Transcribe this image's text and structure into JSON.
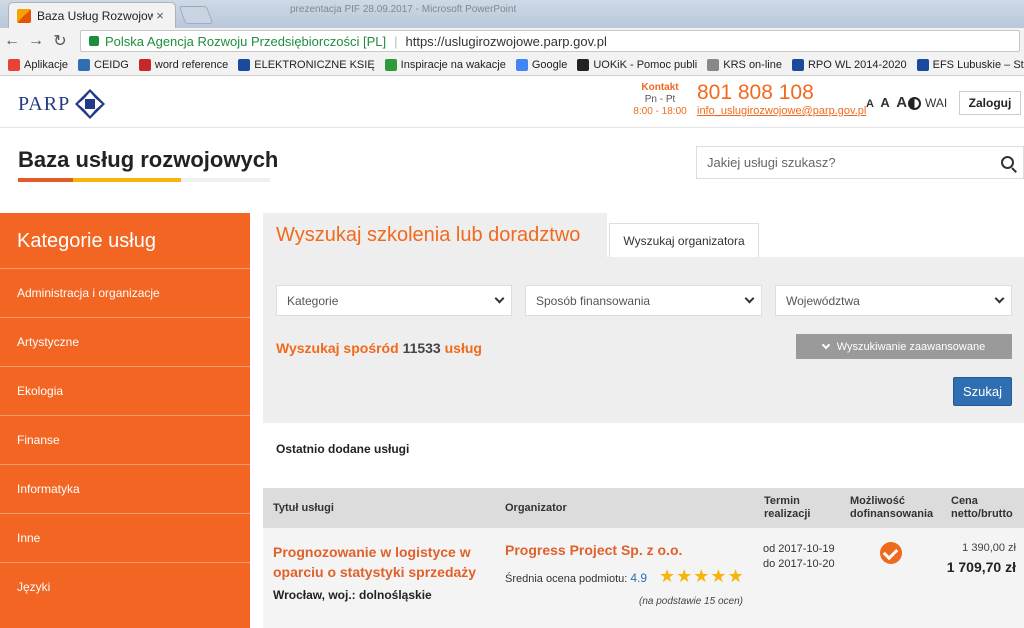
{
  "browser": {
    "tab_title": "Baza Usług Rozwojowych",
    "tab_close": "×",
    "blurred_window": "prezentacja PIF 28.09.2017 - Microsoft PowerPoint",
    "back_icon": "←",
    "forward_icon": "→",
    "reload_icon": "↻",
    "site_identity": "Polska Agencja Rozwoju Przedsiębiorczości [PL]",
    "url_separator": "|",
    "url": "https://uslugirozwojowe.parp.gov.pl",
    "bookmarks": [
      {
        "label": "Aplikacje",
        "icon": "apps-grid-icon",
        "color": "#e94235"
      },
      {
        "label": "CEIDG",
        "icon": "ceidg-icon",
        "color": "#2f6fb1"
      },
      {
        "label": "word reference",
        "icon": "wr-icon",
        "color": "#c62828"
      },
      {
        "label": "ELEKTRONICZNE KSIĘ",
        "icon": "ekw-icon",
        "color": "#1a4a9c"
      },
      {
        "label": "Inspiracje na wakacje",
        "icon": "l-icon",
        "color": "#2e9b3a"
      },
      {
        "label": "Google",
        "icon": "google-icon",
        "color": "#4285f4"
      },
      {
        "label": "UOKiK - Pomoc publi",
        "icon": "u-icon",
        "color": "#222222"
      },
      {
        "label": "KRS on-line",
        "icon": "eagle-icon",
        "color": "#888888"
      },
      {
        "label": "RPO WL 2014-2020",
        "icon": "rpo-icon",
        "color": "#1a4a9c"
      },
      {
        "label": "EFS Lubuskie – Strona",
        "icon": "efs-icon",
        "color": "#1a4a9c"
      }
    ]
  },
  "header": {
    "logo_text": "PARP",
    "contact_title": "Kontakt",
    "contact_days": "Pn - Pt",
    "contact_hours": "8:00 - 18:00",
    "phone": "801 808 108",
    "email": "info_uslugirozwojowe@parp.gov.pl",
    "font_sizes": [
      "A",
      "A",
      "A"
    ],
    "wai_label": "WAI",
    "login_label": "Zaloguj"
  },
  "page": {
    "title": "Baza usług rozwojowych",
    "search_placeholder": "Jakiej usługi szukasz?"
  },
  "sidebar": {
    "title": "Kategorie usług",
    "items": [
      "Administracja i organizacje",
      "Artystyczne",
      "Ekologia",
      "Finanse",
      "Informatyka",
      "Inne",
      "Języki"
    ]
  },
  "search": {
    "tab_active": "Wyszukaj szkolenia lub doradztwo",
    "tab_inactive": "Wyszukaj organizatora",
    "select_category": "Kategorie",
    "select_financing": "Sposób finansowania",
    "select_region": "Województwa",
    "count_prefix": "Wyszukaj spośród ",
    "count_value": "11533",
    "count_suffix": " usług",
    "advanced_label": "Wyszukiwanie zaawansowane",
    "submit_label": "Szukaj"
  },
  "recent": {
    "title": "Ostatnio dodane usługi",
    "headers": {
      "title": "Tytuł usługi",
      "organizer": "Organizator",
      "term_line1": "Termin",
      "term_line2": "realizacji",
      "funding_line1": "Możliwość",
      "funding_line2": "dofinansowania",
      "price_line1": "Cena",
      "price_line2": "netto/brutto"
    },
    "rows": [
      {
        "title": "Prognozowanie w logistyce w oparciu o statystyki sprzedaży",
        "location": "Wrocław, woj.: dolnośląskie",
        "organizer": "Progress Project Sp. z o.o.",
        "rating_label": "Średnia ocena podmiotu: ",
        "rating": "4.9",
        "stars": "★★★★★",
        "rating_basis": "(na podstawie 15 ocen)",
        "date_from": "od 2017-10-19",
        "date_to": "do 2017-10-20",
        "price_net": "1 390,00 zł",
        "price_gross": "1 709,70 zł"
      }
    ]
  },
  "colors": {
    "accent_orange": "#f26522",
    "brand_blue": "#233a86",
    "button_blue": "#2f6fb1",
    "star_yellow": "#f7b40a"
  }
}
